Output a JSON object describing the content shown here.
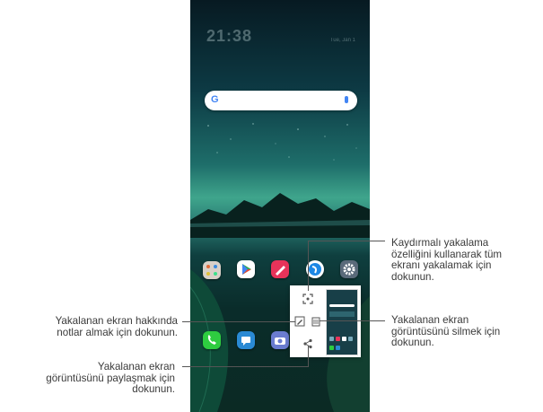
{
  "callouts": {
    "scroll_capture": [
      "Kaydırmalı yakalama",
      "özelliğini kullanarak tüm",
      "ekranı yakalamak için",
      "dokunun."
    ],
    "delete": [
      "Yakalanan ekran",
      "görüntüsünü silmek için",
      "dokunun."
    ],
    "notes": [
      "Yakalanan ekran hakkında",
      "notlar almak için dokunun."
    ],
    "share": [
      "Yakalanan ekran",
      "görüntüsünü paylaşmak için",
      "dokunun."
    ]
  },
  "phone": {
    "search_logo": "G",
    "wallpaper_colors": [
      "#071a22",
      "#3fa58c",
      "#0b2a24"
    ]
  },
  "icons": {
    "home_row": [
      "app-folder-icon",
      "play-store-icon",
      "notes-app-icon",
      "browser-icon",
      "settings-icon"
    ],
    "dock_row": [
      "phone-icon",
      "messages-icon",
      "camera-icon"
    ],
    "popup": [
      "scroll-capture-icon",
      "edit-notes-icon",
      "delete-icon",
      "share-icon"
    ]
  }
}
